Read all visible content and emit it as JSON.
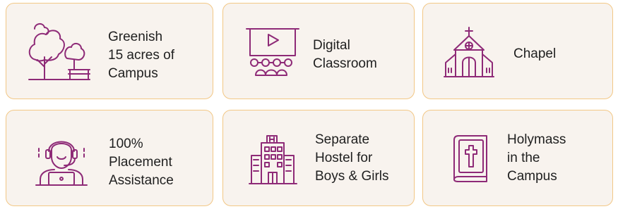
{
  "colors": {
    "card_bg": "#f8f3ee",
    "card_border": "#f2c785",
    "icon": "#8e2a77",
    "text": "#1f1f1f"
  },
  "features": [
    {
      "icon": "trees-bench-icon",
      "label": "Greenish\n15 acres of\nCampus"
    },
    {
      "icon": "digital-classroom-icon",
      "label": "Digital\nClassroom"
    },
    {
      "icon": "chapel-icon",
      "label": "Chapel"
    },
    {
      "icon": "placement-support-icon",
      "label": "100%\nPlacement\nAssistance"
    },
    {
      "icon": "hostel-building-icon",
      "label": "Separate\nHostel for\nBoys & Girls"
    },
    {
      "icon": "holy-bible-icon",
      "label": "Holymass\nin the\nCampus"
    }
  ]
}
